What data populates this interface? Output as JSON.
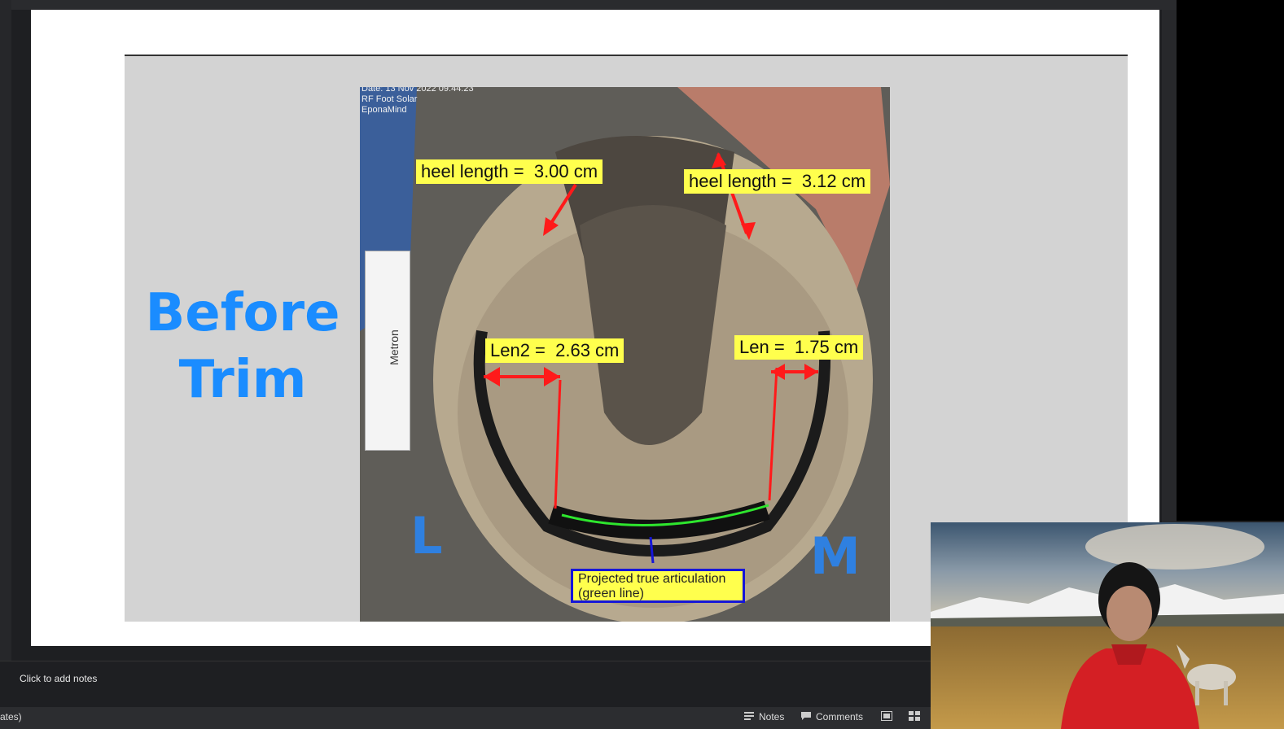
{
  "slide": {
    "title_line1": "Before",
    "title_line2": "Trim",
    "photo_meta": [
      "Date: 13 Nov 2022  09:44:23",
      "RF Foot Solar",
      "EponaMind"
    ],
    "labels": {
      "heel_left": "heel length =  3.00 cm",
      "heel_right": "heel length =  3.12 cm",
      "len2": "Len2 =  2.63 cm",
      "len": "Len =  1.75 cm",
      "articulation_line1": "Projected true articulation",
      "articulation_line2": "(green line)"
    },
    "letter_left": "L",
    "letter_right": "M",
    "ruler_text": "Metron"
  },
  "notes": {
    "placeholder": "Click to add notes"
  },
  "statusbar": {
    "left_text": "ates)",
    "notes_label": "Notes",
    "comments_label": "Comments"
  },
  "colors": {
    "accent_blue": "#1a8cff",
    "label_yellow": "#ffff4d",
    "arrow_red": "#ff1a1a",
    "green_line": "#2ee62e"
  }
}
